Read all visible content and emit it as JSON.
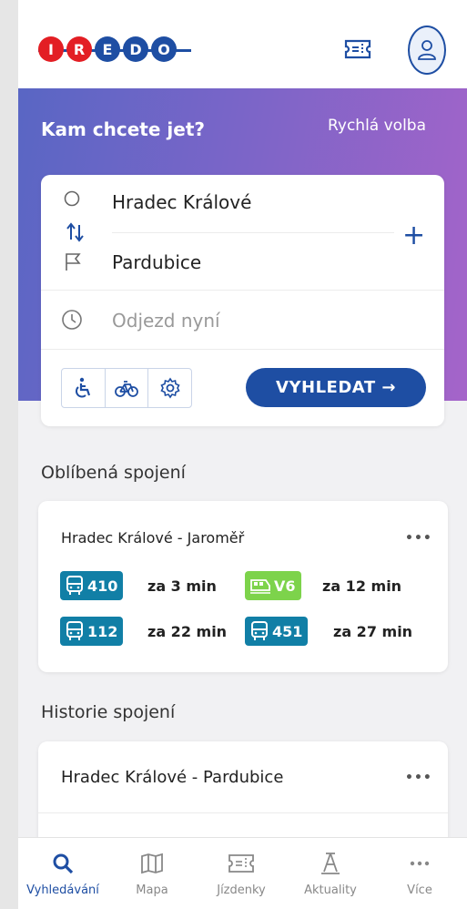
{
  "header": {
    "logo_letters": [
      "I",
      "R",
      "E",
      "D",
      "O"
    ],
    "ticket_icon": "ticket-icon",
    "avatar_icon": "user-icon"
  },
  "hero": {
    "title": "Kam chcete jet?",
    "quick_select": "Rychlá volba"
  },
  "search": {
    "from": "Hradec Králové",
    "to": "Pardubice",
    "departure_placeholder": "Odjezd nyní",
    "search_button": "VYHLEDAT →",
    "options": [
      "wheelchair-icon",
      "bicycle-icon",
      "settings-icon"
    ]
  },
  "favorites": {
    "section_title": "Oblíbená spojení",
    "route": "Hradec Králové - Jaroměř",
    "more": "•••",
    "connections": [
      {
        "type": "bus",
        "line": "410",
        "eta": "za 3 min"
      },
      {
        "type": "train",
        "line": "V6",
        "eta": "za 12 min"
      },
      {
        "type": "bus",
        "line": "112",
        "eta": "za 22 min"
      },
      {
        "type": "bus",
        "line": "451",
        "eta": "za 27 min"
      }
    ]
  },
  "history": {
    "section_title": "Historie spojení",
    "route": "Hradec Králové - Pardubice",
    "more": "•••"
  },
  "tabs": [
    {
      "label": "Vyhledávání",
      "icon": "search-icon",
      "active": true
    },
    {
      "label": "Mapa",
      "icon": "map-icon",
      "active": false
    },
    {
      "label": "Jízdenky",
      "icon": "ticket-icon",
      "active": false
    },
    {
      "label": "Aktuality",
      "icon": "road-icon",
      "active": false
    },
    {
      "label": "Více",
      "icon": "more-icon",
      "active": false
    }
  ],
  "colors": {
    "brand_blue": "#1e4ea3",
    "brand_red": "#e31e24",
    "bus_badge": "#117fa6",
    "train_badge": "#7dd34b",
    "hero_gradient_start": "#5966c4",
    "hero_gradient_end": "#a564c9"
  }
}
